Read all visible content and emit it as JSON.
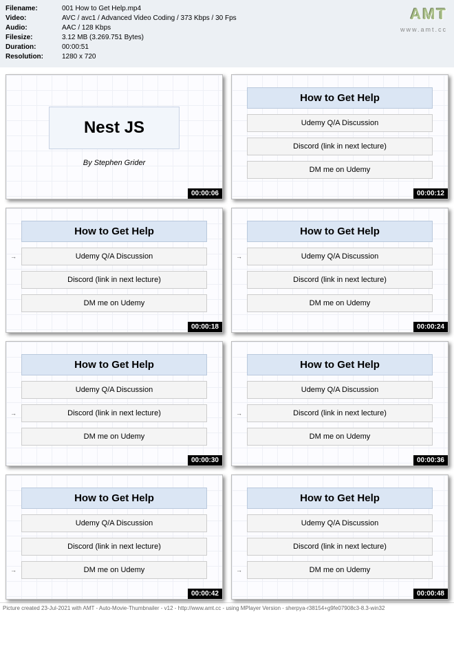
{
  "info": {
    "labels": {
      "filename": "Filename:",
      "video": "Video:",
      "audio": "Audio:",
      "filesize": "Filesize:",
      "duration": "Duration:",
      "resolution": "Resolution:"
    },
    "values": {
      "filename": "001 How to Get Help.mp4",
      "video": "AVC / avc1 / Advanced Video Coding / 373 Kbps / 30 Fps",
      "audio": "AAC / 128 Kbps",
      "filesize": "3.12 MB (3.269.751 Bytes)",
      "duration": "00:00:51",
      "resolution": "1280 x 720"
    }
  },
  "logo": {
    "text": "AMT",
    "url": "www.amt.cc"
  },
  "title_slide": {
    "title": "Nest JS",
    "author": "By Stephen Grider"
  },
  "help": {
    "header": "How to Get Help",
    "item1": "Udemy Q/A Discussion",
    "item2": "Discord (link in next lecture)",
    "item3": "DM me on Udemy"
  },
  "thumbs": [
    {
      "ts": "00:00:06",
      "kind": "title"
    },
    {
      "ts": "00:00:12",
      "kind": "help",
      "arrow": -1
    },
    {
      "ts": "00:00:18",
      "kind": "help",
      "arrow": 0
    },
    {
      "ts": "00:00:24",
      "kind": "help",
      "arrow": 0
    },
    {
      "ts": "00:00:30",
      "kind": "help",
      "arrow": 1
    },
    {
      "ts": "00:00:36",
      "kind": "help",
      "arrow": 1
    },
    {
      "ts": "00:00:42",
      "kind": "help",
      "arrow": 2
    },
    {
      "ts": "00:00:48",
      "kind": "help",
      "arrow": 2
    }
  ],
  "footer": "Picture created 23-Jul-2021 with AMT - Auto-Movie-Thumbnailer - v12 - http://www.amt.cc - using MPlayer Version - sherpya-r38154+g9fe07908c3-8.3-win32"
}
